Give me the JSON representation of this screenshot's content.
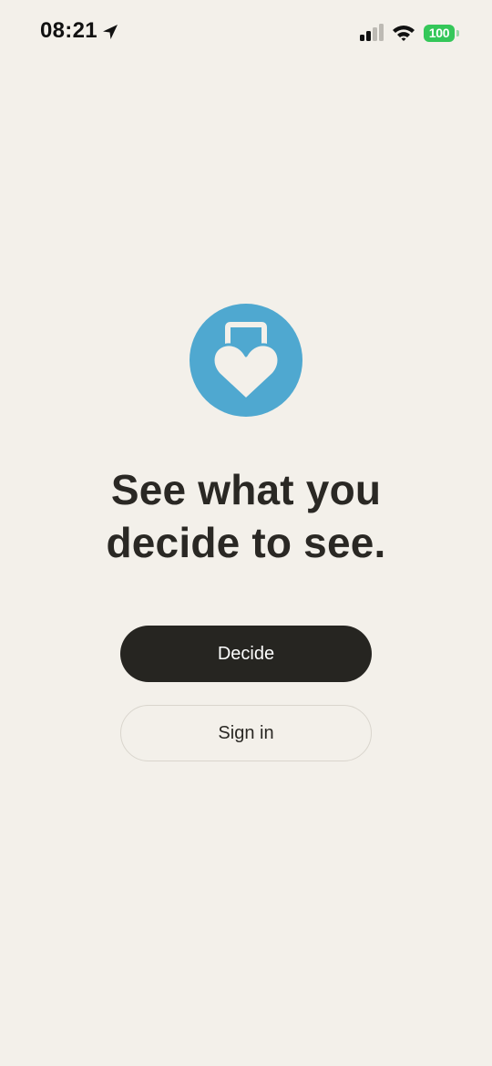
{
  "status_bar": {
    "time": "08:21",
    "battery_level": "100",
    "icons": [
      "location-arrow-icon",
      "cellular-signal-icon",
      "wifi-icon",
      "battery-icon"
    ]
  },
  "logo": {
    "icon": "heart-lock-icon",
    "color": "#4fa8d0"
  },
  "headline": {
    "line1": "See what you",
    "line2": "decide to see."
  },
  "actions": {
    "primary_label": "Decide",
    "secondary_label": "Sign in"
  },
  "colors": {
    "background": "#f3f0ea",
    "primary_button": "#262521",
    "battery": "#34c759"
  }
}
